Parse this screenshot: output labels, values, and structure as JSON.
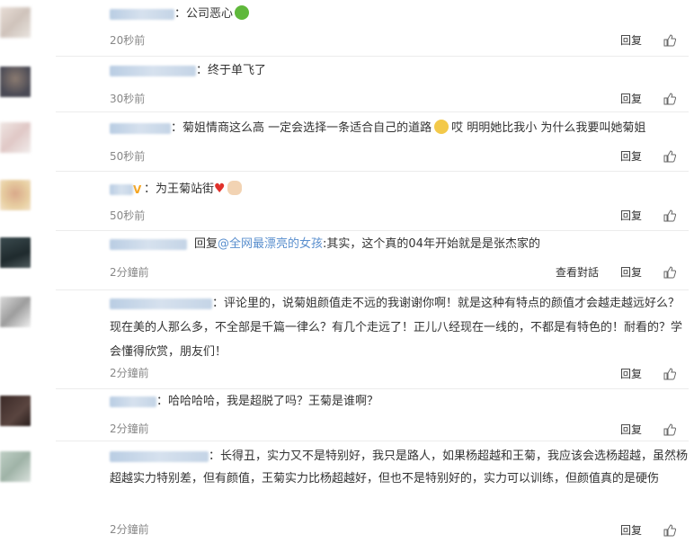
{
  "comments": [
    {
      "text": "公司恶心",
      "time": "20秒前",
      "reply": "回复"
    },
    {
      "text": "终于单飞了",
      "time": "30秒前",
      "reply": "回复"
    },
    {
      "text": "菊姐情商这么高 一定会选择一条适合自己的道路",
      "text2": "哎 明明她比我小 为什么我要叫她菊姐",
      "time": "50秒前",
      "reply": "回复"
    },
    {
      "text": "为王菊站街",
      "time": "50秒前",
      "reply": "回复"
    },
    {
      "prefix": "回复",
      "mention": "@全网最漂亮的女孩",
      "text": ":其实，这个真的04年开始就是是张杰家的",
      "time": "2分鐘前",
      "view": "查看對話",
      "reply": "回复"
    },
    {
      "text": "评论里的，说菊姐颜值走不远的我谢谢你啊！就是这种有特点的颜值才会越走越远好么？现在美的人那么多，不全部是千篇一律么？有几个走远了！正儿八经现在一线的，不都是有特色的！耐看的？学会懂得欣赏，朋友们！",
      "time": "2分鐘前",
      "reply": "回复"
    },
    {
      "text": "哈哈哈哈，我是超脱了吗？王菊是谁啊？",
      "time": "2分鐘前",
      "reply": "回复"
    },
    {
      "text": "长得丑，实力又不是特别好，我只是路人，如果杨超越和王菊，我应该会选杨超越，虽然杨超越实力特别差，但有颜值，王菊实力比杨超越好，但也不是特别好的，实力可以训练，但颜值真的是硬伤",
      "time": "2分鐘前",
      "reply": "回复"
    }
  ],
  "colors": {
    "link": "#5a8fce",
    "time": "#888888",
    "divider": "#ececec"
  }
}
